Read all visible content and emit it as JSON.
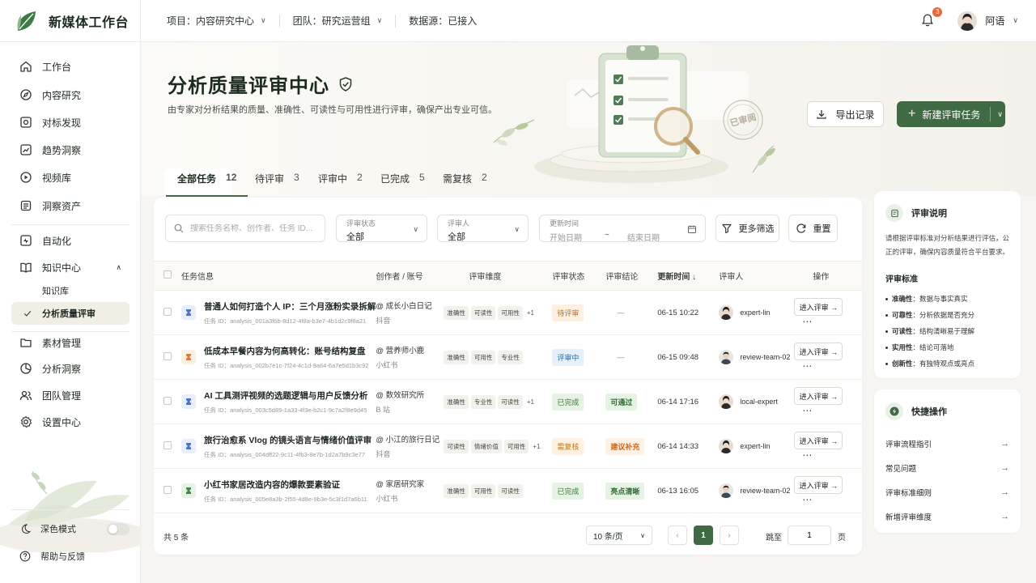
{
  "brand": {
    "title": "新媒体工作台"
  },
  "topbar": {
    "project": "项目：内容研究中心",
    "team": "团队：研究运营组",
    "datasource": "数据源：已接入",
    "notification_count": "3",
    "user_name": "阿语"
  },
  "sidebar": {
    "items": [
      {
        "label": "工作台",
        "icon": "home-icon"
      },
      {
        "label": "内容研究",
        "icon": "compass-icon"
      },
      {
        "label": "对标发现",
        "icon": "target-icon"
      },
      {
        "label": "趋势洞察",
        "icon": "trend-icon"
      },
      {
        "label": "视频库",
        "icon": "video-icon"
      },
      {
        "label": "洞察资产",
        "icon": "layers-icon"
      },
      {
        "label": "自动化",
        "icon": "automation-icon"
      },
      {
        "label": "知识中心",
        "icon": "book-icon"
      },
      {
        "label": "知识库",
        "icon": ""
      },
      {
        "label": "分析质量评审",
        "icon": "check-icon"
      },
      {
        "label": "素材管理",
        "icon": "folder-icon"
      },
      {
        "label": "分析洞察",
        "icon": "chart-icon"
      },
      {
        "label": "团队管理",
        "icon": "team-icon"
      },
      {
        "label": "设置中心",
        "icon": "gear-icon"
      }
    ],
    "dark_mode": "深色模式",
    "help": "帮助与反馈"
  },
  "hero": {
    "title": "分析质量评审中心",
    "subtitle": "由专家对分析结果的质量、准确性、可读性与可用性进行评审，确保产出专业可信。",
    "export_label": "导出记录",
    "new_label": "新建评审任务",
    "stamp": "已审阅"
  },
  "tabs": [
    {
      "label": "全部任务",
      "count": "12"
    },
    {
      "label": "待评审",
      "count": "3"
    },
    {
      "label": "评审中",
      "count": "2"
    },
    {
      "label": "已完成",
      "count": "5"
    },
    {
      "label": "需复核",
      "count": "2"
    }
  ],
  "filters": {
    "search_placeholder": "搜索任务名称、创作者、任务 ID...",
    "status_label": "评审状态",
    "status_value": "全部",
    "reviewer_label": "评审人",
    "reviewer_value": "全部",
    "time_label": "更新时间",
    "start_date": "开始日期",
    "date_sep": "~",
    "end_date": "结束日期",
    "more_label": "更多筛选",
    "reset_label": "重置"
  },
  "table": {
    "headers": {
      "task": "任务信息",
      "creator": "创作者 / 账号",
      "dims": "评审维度",
      "status": "评审状态",
      "conclusion": "评审结论",
      "updated": "更新时间 ↓",
      "reviewer": "评审人",
      "action": "操作"
    },
    "enter_label": "进入评审 →",
    "rows": [
      {
        "title": "普通人如何打造个人 IP：三个月涨粉实录拆解",
        "id": "任务 ID：analysis_001a3f6b-8d12-4f8a-b3e7-4b1d2c9f8a21",
        "creator": "@ 成长小白日记",
        "platform": "抖音",
        "dims": [
          "准确性",
          "可读性",
          "可用性"
        ],
        "extra": "+1",
        "status": "待评审",
        "conclusion": "—",
        "time": "06-15 10:22",
        "reviewer": "expert-lin",
        "icon_color": "#4a74c9",
        "icon_bg": "#e8eefb"
      },
      {
        "title": "低成本早餐内容为何高转化：账号结构复盘",
        "id": "任务 ID：analysis_002b7e1c-7f24-4c1d-9a64-6a7e5d1b3c92",
        "creator": "@ 营养师小鹿",
        "platform": "小红书",
        "dims": [
          "准确性",
          "可用性",
          "专业性"
        ],
        "extra": "",
        "status": "评审中",
        "conclusion": "—",
        "time": "06-15 09:48",
        "reviewer": "review-team-02",
        "icon_color": "#e07a38",
        "icon_bg": "#fcefe4"
      },
      {
        "title": "AI 工具测评视频的选题逻辑与用户反馈分析",
        "id": "任务 ID：analysis_003c5d89-1a33-4f3e-b2c1-9c7a2f8e9d45",
        "creator": "@ 数效研究所",
        "platform": "B 站",
        "dims": [
          "准确性",
          "专业性",
          "可读性"
        ],
        "extra": "+1",
        "status": "已完成",
        "conclusion": "可通过",
        "time": "06-14 17:16",
        "reviewer": "local-expert",
        "icon_color": "#4a74c9",
        "icon_bg": "#e8eefb"
      },
      {
        "title": "旅行治愈系 Vlog 的镜头语言与情绪价值评审",
        "id": "任务 ID：analysis_004dff22-9c11-4fb3-8e7b-1d2a7b9c3e77",
        "creator": "@ 小江的旅行日记",
        "platform": "抖音",
        "dims": [
          "可读性",
          "情绪价值",
          "可用性"
        ],
        "extra": "+1",
        "status": "需复核",
        "conclusion": "建议补充",
        "time": "06-14 14:33",
        "reviewer": "expert-lin",
        "icon_color": "#4a74c9",
        "icon_bg": "#e8eefb"
      },
      {
        "title": "小红书家居改造内容的爆款要素验证",
        "id": "任务 ID：analysis_005e8a3b-2f55-4d8e-9b3e-5c3f1d7a6b11",
        "creator": "@ 家居研究家",
        "platform": "小红书",
        "dims": [
          "准确性",
          "可用性",
          "可读性"
        ],
        "extra": "",
        "status": "已完成",
        "conclusion": "亮点清晰",
        "time": "06-13 16:05",
        "reviewer": "review-team-02",
        "icon_color": "#3f8a46",
        "icon_bg": "#e6f2e4"
      }
    ]
  },
  "pagination": {
    "total": "共 5 条",
    "per_page": "10 条/页",
    "prev": "‹",
    "current": "1",
    "next": "›",
    "jump_label": "跳至",
    "jump_value": "1",
    "page_label": "页"
  },
  "review_panel": {
    "title": "评审说明",
    "desc": "请根据评审标准对分析结果进行评估，公正的评审，确保内容质量符合平台要求。",
    "std_title": "评审标准",
    "standards": [
      {
        "name": "准确性",
        "desc": "：数据与事实真实"
      },
      {
        "name": "可靠性",
        "desc": "：分析依据是否充分"
      },
      {
        "name": "可读性",
        "desc": "：结构清晰易于理解"
      },
      {
        "name": "实用性",
        "desc": "：结论可落地"
      },
      {
        "name": "创新性",
        "desc": "：有独特观点或亮点"
      }
    ]
  },
  "quick_panel": {
    "title": "快捷操作",
    "items": [
      "评审流程指引",
      "常见问题",
      "评审标准细则",
      "新增评审维度"
    ]
  },
  "colors": {
    "accent": "#3f6a44",
    "pending": "#c26f19",
    "review": "#2d6aa5",
    "done": "#3a7a3c"
  }
}
